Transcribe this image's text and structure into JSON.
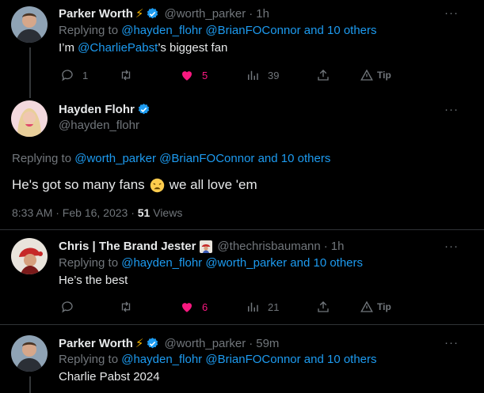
{
  "tweets": [
    {
      "name": "Parker Worth",
      "bolt": "⚡",
      "handle": "@worth_parker",
      "time": "1h",
      "replying_prefix": "Replying to",
      "replying_to": "@hayden_flohr @BrianFOConnor and 10 others",
      "text_pre": "I’m ",
      "text_mention": "@CharliePabst",
      "text_post": "’s biggest fan",
      "replies": "1",
      "likes": "5",
      "views": "39",
      "tip": "Tip"
    },
    {
      "name": "Hayden Flohr",
      "handle": "@hayden_flohr",
      "replying_prefix": "Replying to",
      "replying_to": "@worth_parker @BrianFOConnor and 10 others",
      "text_pre": "He's got so many fans",
      "text_post": "we all love 'em",
      "timestamp": "8:33 AM · Feb 16, 2023 · ",
      "view_count": "51",
      "views_label": " Views"
    },
    {
      "name": "Chris | The Brand Jester",
      "handle": "@thechrisbaumann",
      "time": "1h",
      "replying_prefix": "Replying to",
      "replying_to": "@hayden_flohr @worth_parker and 10 others",
      "text": "He’s the best",
      "likes": "6",
      "views": "21",
      "tip": "Tip"
    },
    {
      "name": "Parker Worth",
      "bolt": "⚡",
      "handle": "@worth_parker",
      "time": "59m",
      "replying_prefix": "Replying to",
      "replying_to": "@hayden_flohr @BrianFOConnor and 10 others",
      "text": "Charlie Pabst 2024"
    }
  ],
  "more_label": "···",
  "dot": "·",
  "colors": {
    "accent": "#1d9bf0",
    "like": "#f91880",
    "muted": "#71767b",
    "text": "#e7e9ea",
    "background": "#000000"
  }
}
